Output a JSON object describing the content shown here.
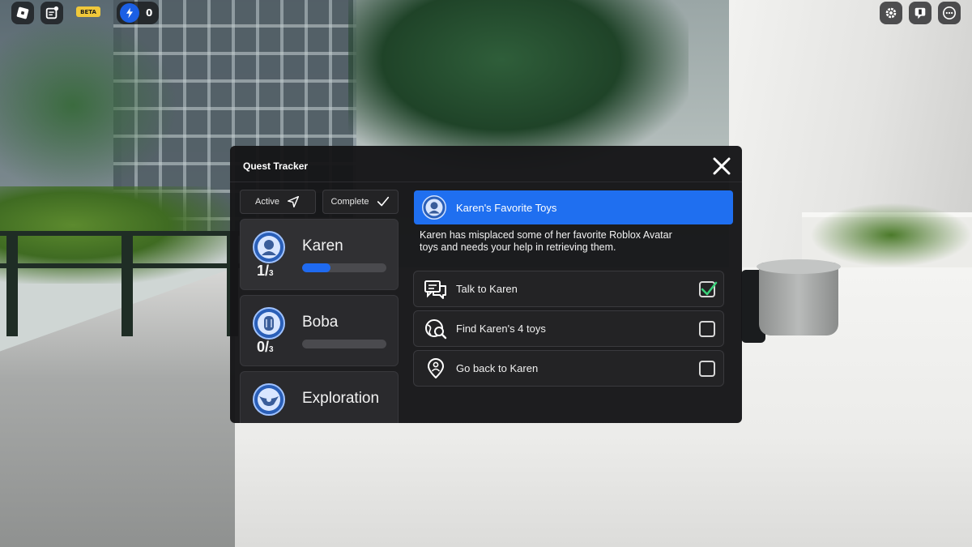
{
  "hud": {
    "beta_label": "BETA",
    "energy_count": "0",
    "left_icons": [
      "roblox-logo-icon",
      "chat-notes-icon"
    ],
    "right_icons": [
      "gear-icon",
      "emote-icon",
      "more-icon"
    ]
  },
  "panel": {
    "title": "Quest Tracker",
    "filters": {
      "active_label": "Active",
      "complete_label": "Complete"
    },
    "quests": [
      {
        "name": "Karen",
        "progress_current": "1",
        "progress_total": "3",
        "progress_fraction": 0.3333,
        "selected": true
      },
      {
        "name": "Boba",
        "progress_current": "0",
        "progress_total": "3",
        "progress_fraction": 0.0,
        "selected": false
      },
      {
        "name": "Exploration",
        "progress_current": "",
        "progress_total": "",
        "progress_fraction": null,
        "selected": false
      }
    ],
    "detail": {
      "title": "Karen's Favorite Toys",
      "description": "Karen has misplaced some of her favorite Roblox Avatar toys and needs your help in retrieving them.",
      "tasks": [
        {
          "label": "Talk to Karen",
          "completed": true,
          "icon": "chat-bubbles-icon"
        },
        {
          "label": "Find Karen's 4 toys",
          "completed": false,
          "icon": "globe-search-icon"
        },
        {
          "label": "Go back to Karen",
          "completed": false,
          "icon": "location-pin-icon"
        }
      ]
    }
  },
  "colors": {
    "accent_blue": "#1f6ff0",
    "panel_bg": "#161618",
    "check_green": "#3ad17a",
    "beta_yellow": "#f0c83a"
  }
}
